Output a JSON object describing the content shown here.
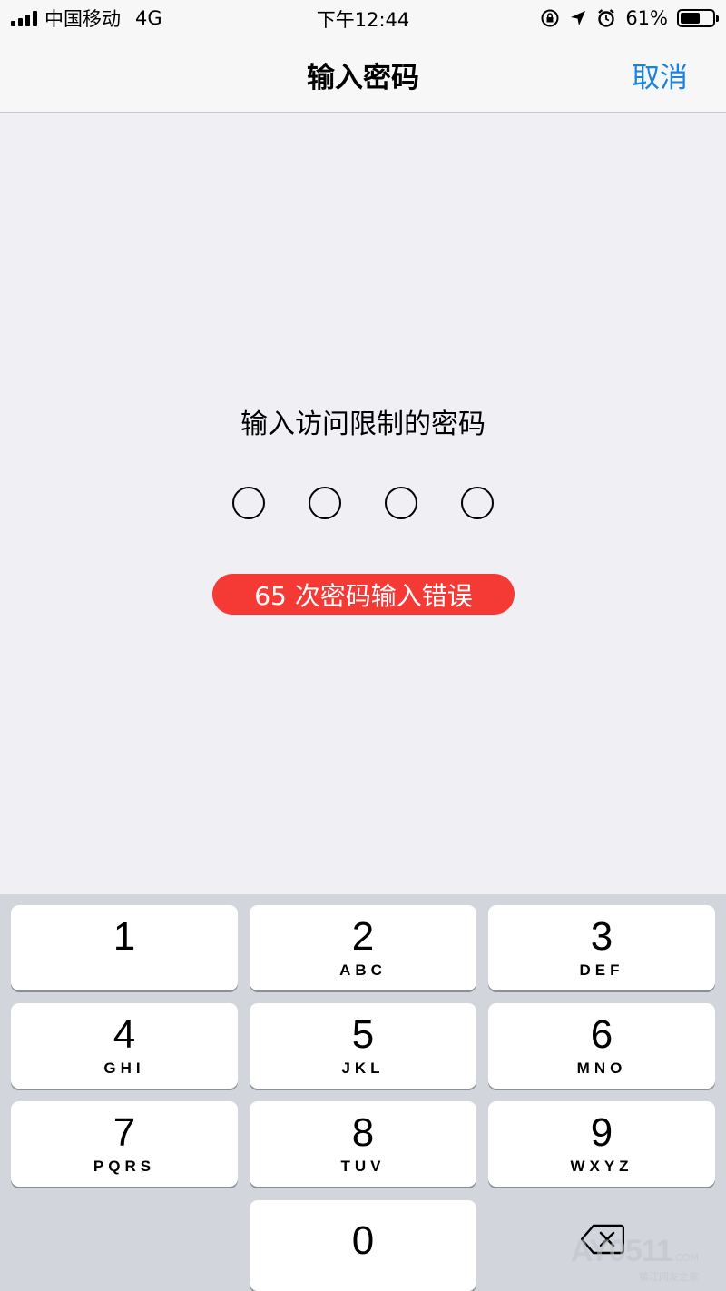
{
  "status_bar": {
    "carrier": "中国移动",
    "network": "4G",
    "time": "下午12:44",
    "battery_text": "61%",
    "battery_level": 0.61,
    "icons": [
      "orientation-lock-icon",
      "location-arrow-icon",
      "alarm-icon",
      "battery-icon"
    ]
  },
  "nav": {
    "title": "输入密码",
    "cancel_label": "取消",
    "accent_color": "#1a82e2"
  },
  "passcode": {
    "prompt": "输入访问限制的密码",
    "digit_count": 4,
    "error_message": "65 次密码输入错误",
    "error_color": "#f53a35"
  },
  "keypad": {
    "keys": [
      {
        "digit": "1",
        "letters": ""
      },
      {
        "digit": "2",
        "letters": "ABC"
      },
      {
        "digit": "3",
        "letters": "DEF"
      },
      {
        "digit": "4",
        "letters": "GHI"
      },
      {
        "digit": "5",
        "letters": "JKL"
      },
      {
        "digit": "6",
        "letters": "MNO"
      },
      {
        "digit": "7",
        "letters": "PQRS"
      },
      {
        "digit": "8",
        "letters": "TUV"
      },
      {
        "digit": "9",
        "letters": "WXYZ"
      },
      {
        "digit": "0",
        "letters": ""
      }
    ],
    "delete_icon": "backspace-icon"
  },
  "watermark": {
    "main": "AY0511",
    "suffix": ".COM",
    "sub": "镇江网友之家"
  }
}
